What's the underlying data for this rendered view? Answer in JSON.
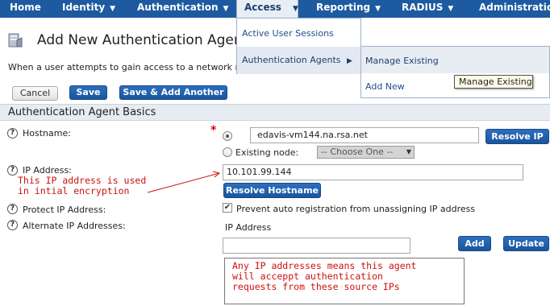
{
  "nav": {
    "items": [
      {
        "label": "Home"
      },
      {
        "label": "Identity"
      },
      {
        "label": "Authentication"
      },
      {
        "label": "Access"
      },
      {
        "label": "Reporting"
      },
      {
        "label": "RADIUS"
      },
      {
        "label": "Administration"
      }
    ]
  },
  "access_menu": {
    "items": [
      {
        "label": "Active User Sessions"
      },
      {
        "label": "Authentication Agents"
      }
    ],
    "submenu": {
      "items": [
        {
          "label": "Manage Existing"
        },
        {
          "label": "Add New"
        }
      ]
    },
    "tooltip": "Manage Existing"
  },
  "page": {
    "title": "Add New Authentication Agent",
    "intro": "When a user attempts to gain access to a network resource"
  },
  "buttons": {
    "cancel": "Cancel",
    "save": "Save",
    "save_add": "Save & Add Another",
    "resolve_ip": "Resolve IP",
    "resolve_hostname": "Resolve Hostname",
    "add": "Add",
    "update": "Update"
  },
  "section": {
    "title": "Authentication Agent Basics"
  },
  "form": {
    "hostname_label": "Hostname:",
    "hostname_value": "edavis-vm144.na.rsa.net",
    "existing_node_label": "Existing node:",
    "existing_node_select": "-- Choose One --",
    "ip_label": "IP Address:",
    "ip_value": "10.101.99.144",
    "protect_label": "Protect IP Address:",
    "protect_checkbox_label": "Prevent auto registration from unassigning IP address",
    "protect_checked": true,
    "alt_label": "Alternate IP Addresses:",
    "alt_column_header": "IP Address",
    "alt_input_value": ""
  },
  "annotations": {
    "ip_note": "This IP address is used\nin intial encryption",
    "alt_note": "Any IP addresses means this agent\nwill acceppt authentication\nrequests from these source IPs"
  },
  "colors": {
    "nav_bg": "#1d5aa0",
    "button_blue": "#1a559c",
    "annotation_red": "#cc1111",
    "section_bg": "#e7ebf2"
  }
}
